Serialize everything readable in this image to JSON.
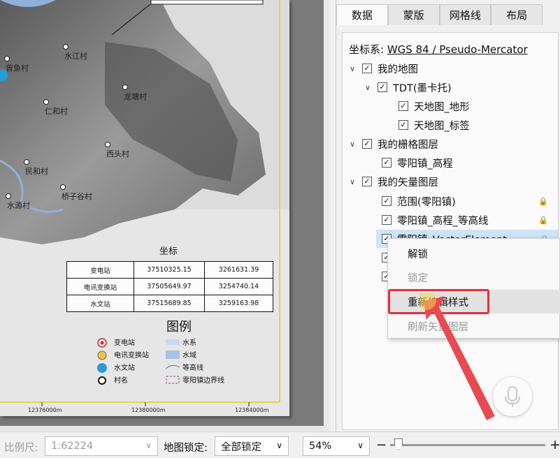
{
  "map": {
    "villages": [
      "曾鱼村",
      "水江村",
      "仁和村",
      "龙塘村",
      "西头村",
      "民和村",
      "桥子谷村",
      "水源村"
    ],
    "coord_table": {
      "title": "坐标",
      "rows": [
        [
          "变电站",
          "37510325.15",
          "3261631.39"
        ],
        [
          "电讯变换站",
          "37505649.97",
          "3254740.14"
        ],
        [
          "水文站",
          "37515689.85",
          "3259163.98"
        ]
      ]
    },
    "legend": {
      "title": "图例",
      "items": [
        {
          "label": "变电站",
          "icon": "substation-icon"
        },
        {
          "label": "水系",
          "icon": "river-icon"
        },
        {
          "label": "电讯变换站",
          "icon": "telecom-icon"
        },
        {
          "label": "水域",
          "icon": "water-area-icon"
        },
        {
          "label": "水文站",
          "icon": "hydrology-icon"
        },
        {
          "label": "等高线",
          "icon": "contour-icon"
        },
        {
          "label": "村名",
          "icon": "village-icon"
        },
        {
          "label": "零阳镇边界线",
          "icon": "boundary-icon"
        }
      ]
    },
    "x_ticks": [
      "12376000m",
      "12380000m",
      "12384000m"
    ]
  },
  "tabs": [
    {
      "label": "数据",
      "active": true
    },
    {
      "label": "蒙版",
      "active": false
    },
    {
      "label": "网格线",
      "active": false
    },
    {
      "label": "布局",
      "active": false
    }
  ],
  "crs": {
    "label": "坐标系:",
    "value": "WGS 84 / Pseudo-Mercator"
  },
  "tree": [
    {
      "label": "我的地图",
      "level": 0,
      "expanded": true,
      "checked": true
    },
    {
      "label": "TDT(墨卡托)",
      "level": 1,
      "expanded": true,
      "checked": true
    },
    {
      "label": "天地图_地形",
      "level": 2,
      "checked": true
    },
    {
      "label": "天地图_标签",
      "level": 2,
      "checked": true
    },
    {
      "label": "我的栅格图层",
      "level": 0,
      "expanded": true,
      "checked": true
    },
    {
      "label": "零阳镇_高程",
      "level": 1,
      "checked": true
    },
    {
      "label": "我的矢量图层",
      "level": 0,
      "expanded": true,
      "checked": true
    },
    {
      "label": "范围(零阳镇)",
      "level": 1,
      "checked": true,
      "locked": true
    },
    {
      "label": "零阳镇_高程_等高线",
      "level": 1,
      "checked": true,
      "locked": true
    },
    {
      "label": "零阳镇_VectorElement",
      "level": 1,
      "checked": true,
      "locked": true,
      "selected": true
    }
  ],
  "context_menu": [
    {
      "label": "解锁",
      "enabled": true
    },
    {
      "label": "锁定",
      "enabled": false
    },
    {
      "label": "重新编辑样式",
      "enabled": true,
      "hover": true
    },
    {
      "label": "刷新矢量图层",
      "enabled": false
    }
  ],
  "status_bar": {
    "scale_label": "比例尺:",
    "scale_value": "1:62224",
    "lock_label": "地图锁定:",
    "lock_value": "全部锁定",
    "zoom_value": "54%",
    "zoom_minus": "−",
    "zoom_plus": "+"
  },
  "colors": {
    "highlight": "#e0323c",
    "selection": "#cce4f7",
    "accent_blue": "#3a7bd5"
  }
}
